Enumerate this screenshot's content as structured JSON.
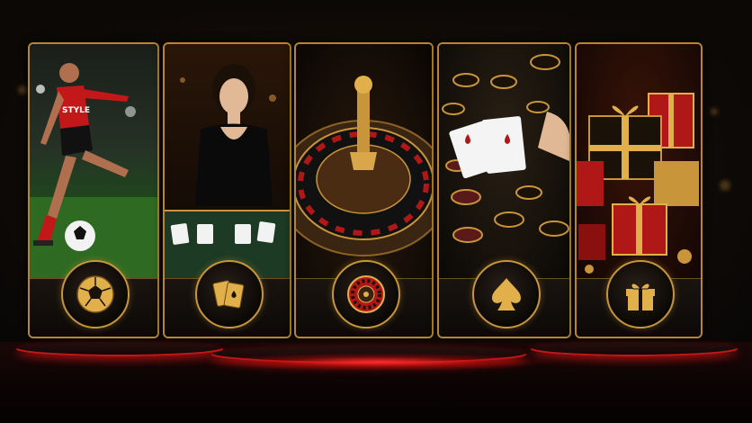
{
  "cards": [
    {
      "name": "sports",
      "icon": "soccer-ball-icon",
      "jersey_text": "STYLE"
    },
    {
      "name": "live-casino",
      "icon": "playing-cards-icon"
    },
    {
      "name": "roulette",
      "icon": "roulette-wheel-icon"
    },
    {
      "name": "poker",
      "icon": "spade-icon"
    },
    {
      "name": "promotions",
      "icon": "gift-box-icon"
    }
  ],
  "colors": {
    "gold": "#c8953a",
    "red": "#d02020",
    "background": "#070707"
  }
}
